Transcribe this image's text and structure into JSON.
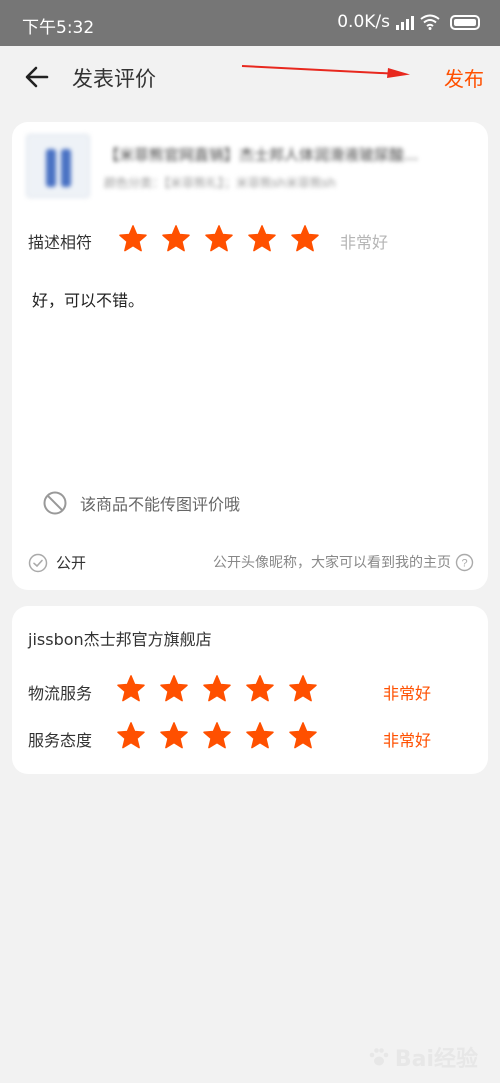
{
  "status_bar": {
    "time": "下午5:32",
    "speed": "0.0K/s",
    "network": "HD"
  },
  "header": {
    "title": "发表评价",
    "publish_label": "发布"
  },
  "product": {
    "title": "【米菲熊官网直销】杰士邦人体润滑液玻尿酸...",
    "subtitle": "颜色分类：【米菲熊礼】；米菲熊sh米菲熊sh"
  },
  "item_rating": {
    "label": "描述相符",
    "stars": 5,
    "grade": "非常好"
  },
  "comment": {
    "text": "好，可以不错。"
  },
  "no_image_notice": "该商品不能传图评价哦",
  "privacy": {
    "public_label": "公开",
    "hint": "公开头像昵称，大家可以看到我的主页"
  },
  "shop": {
    "name": "jissbon杰士邦官方旗舰店",
    "ratings": [
      {
        "label": "物流服务",
        "stars": 5,
        "grade": "非常好"
      },
      {
        "label": "服务态度",
        "stars": 5,
        "grade": "非常好"
      }
    ]
  },
  "watermark": "Bai经验",
  "colors": {
    "accent": "#ff5000",
    "grade_muted": "#b5b5b5",
    "background": "#f2f2f2"
  }
}
